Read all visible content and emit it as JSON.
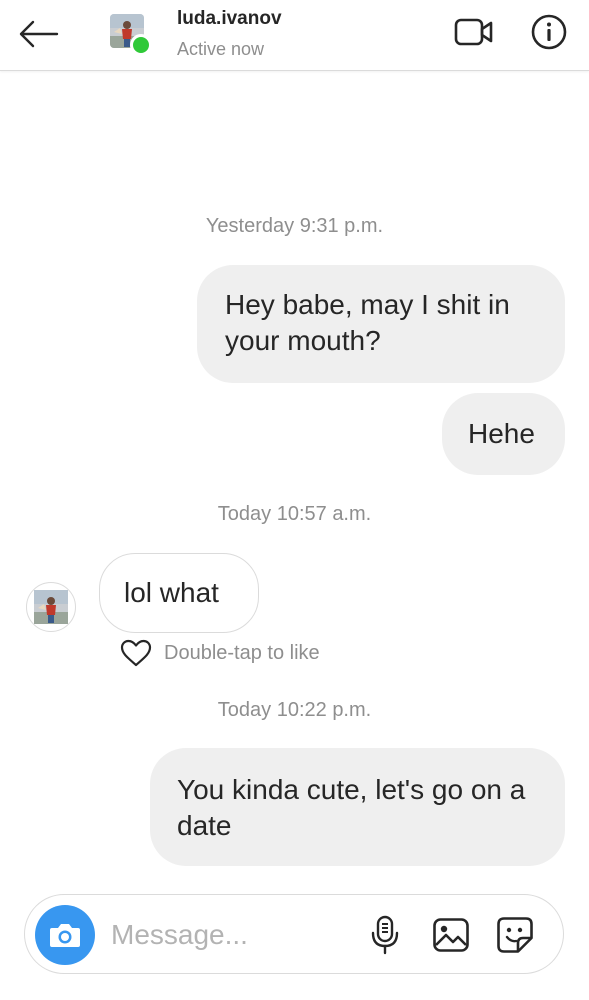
{
  "header": {
    "username": "luda.ivanov",
    "status": "Active now",
    "avatar_icon": "profile-photo",
    "online_color": "#2fc938"
  },
  "thread": {
    "timestamps": [
      "Yesterday 9:31 p.m.",
      "Today 10:57 a.m.",
      "Today 10:22 p.m."
    ],
    "messages": [
      {
        "direction": "outgoing",
        "text": "Hey babe, may I shit in your mouth?"
      },
      {
        "direction": "outgoing",
        "text": "Hehe"
      },
      {
        "direction": "incoming",
        "text": "lol what"
      },
      {
        "direction": "outgoing",
        "text": "You kinda cute, let's go on a date"
      }
    ],
    "like_hint": "Double-tap to like"
  },
  "composer": {
    "placeholder": "Message...",
    "value": "",
    "accent_color": "#3897f0"
  }
}
